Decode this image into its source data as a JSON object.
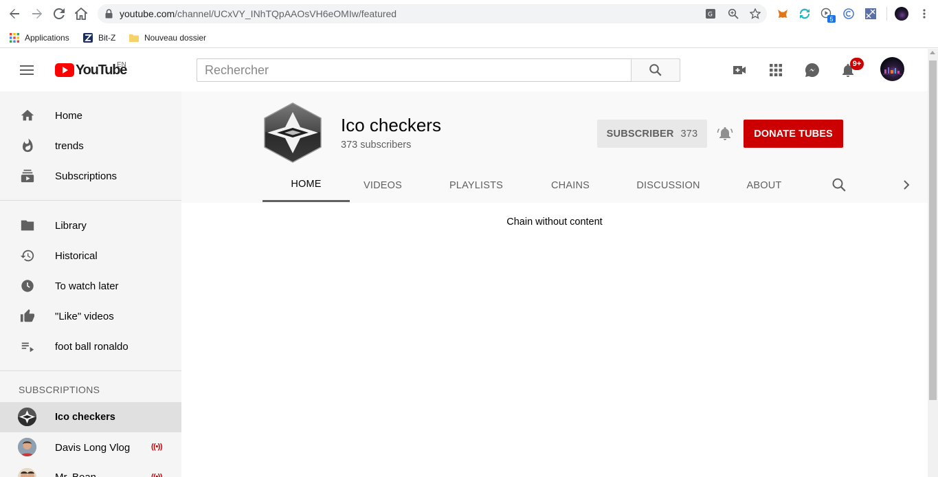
{
  "browser": {
    "url_host": "youtube.com",
    "url_path": "/channel/UCxVY_INhTQpAAOsVH6eOMIw/featured",
    "bookmarks": [
      {
        "label": "Applications",
        "icon": "apps-grid-icon"
      },
      {
        "label": "Bit-Z",
        "icon": "bitz-logo-icon"
      },
      {
        "label": "Nouveau dossier",
        "icon": "folder-icon"
      }
    ],
    "extension_badge": "5"
  },
  "header": {
    "logo_text": "YouTube",
    "country_code": "EN",
    "search_placeholder": "Rechercher",
    "notification_count": "9+"
  },
  "sidebar": {
    "main_items": [
      {
        "label": "Home",
        "icon": "home-icon"
      },
      {
        "label": "trends",
        "icon": "flame-icon"
      },
      {
        "label": "Subscriptions",
        "icon": "subscriptions-icon"
      }
    ],
    "library_items": [
      {
        "label": "Library",
        "icon": "folder-icon"
      },
      {
        "label": "Historical",
        "icon": "history-icon"
      },
      {
        "label": "To watch later",
        "icon": "clock-icon"
      },
      {
        "label": "\"Like\" videos",
        "icon": "thumbs-up-icon"
      },
      {
        "label": "foot ball ronaldo",
        "icon": "playlist-icon"
      }
    ],
    "subscriptions_heading": "SUBSCRIPTIONS",
    "subscriptions": [
      {
        "label": "Ico checkers",
        "live": false,
        "active": true
      },
      {
        "label": "Davis Long Vlog",
        "live": true,
        "active": false
      },
      {
        "label": "Mr. Bean",
        "live": true,
        "active": false
      }
    ],
    "live_glyph": "((•))"
  },
  "channel": {
    "name": "Ico checkers",
    "subscribers_text": "373 subscribers",
    "subscribe_label": "SUBSCRIBER",
    "subscribe_count": "373",
    "donate_label": "DONATE TUBES",
    "tabs": [
      "HOME",
      "VIDEOS",
      "PLAYLISTS",
      "CHAINS",
      "DISCUSSION",
      "ABOUT"
    ],
    "active_tab": "HOME"
  },
  "content": {
    "empty_message": "Chain without content"
  },
  "colors": {
    "brand_red": "#ff0000",
    "donate_red": "#cc0000",
    "sidebar_bg": "#f5f5f5",
    "channel_header_bg": "#f9f9f9"
  }
}
